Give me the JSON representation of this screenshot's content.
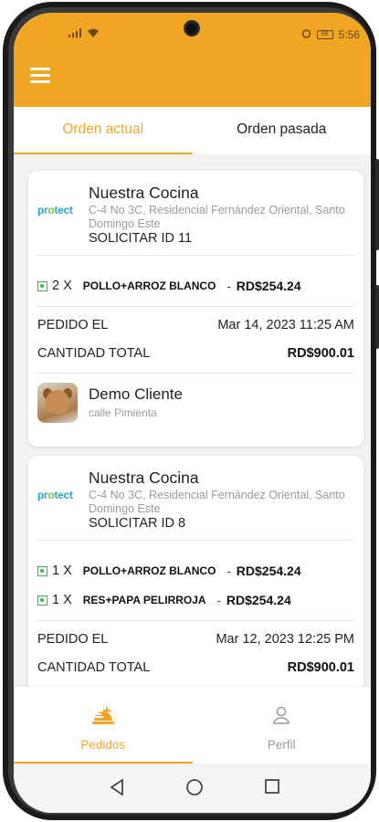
{
  "status_bar": {
    "time": "5:56",
    "battery_text": "88"
  },
  "tabs": [
    {
      "label": "Orden actual",
      "active": true
    },
    {
      "label": "Orden pasada",
      "active": false
    }
  ],
  "orders": [
    {
      "restaurant_logo": {
        "part1": "pr",
        "part2": "o",
        "part3": "tect"
      },
      "restaurant_name": "Nuestra Cocina",
      "address": "C-4 No 3C, Residencial Fernández Oriental, Santo Domingo Este",
      "request_id": "SOLICITAR ID 11",
      "items": [
        {
          "qty": "2 X",
          "name": "POLLO+ARROZ BLANCO",
          "dash": "-",
          "price": "RD$254.24"
        }
      ],
      "ordered_label": "PEDIDO EL",
      "ordered_date": "Mar 14, 2023 11:25 AM",
      "total_label": "CANTIDAD TOTAL",
      "total_value": "RD$900.01",
      "customer": {
        "name": "Demo Cliente",
        "address": "calle Pimienta"
      }
    },
    {
      "restaurant_logo": {
        "part1": "pr",
        "part2": "o",
        "part3": "tect"
      },
      "restaurant_name": "Nuestra Cocina",
      "address": "C-4 No 3C, Residencial Fernández Oriental, Santo Domingo Este",
      "request_id": "SOLICITAR ID 8",
      "items": [
        {
          "qty": "1 X",
          "name": "POLLO+ARROZ BLANCO",
          "dash": "-",
          "price": "RD$254.24"
        },
        {
          "qty": "1 X",
          "name": "RES+PAPA PELIRROJA",
          "dash": "-",
          "price": "RD$254.24"
        }
      ],
      "ordered_label": "PEDIDO EL",
      "ordered_date": "Mar 12, 2023 12:25 PM",
      "total_label": "CANTIDAD TOTAL",
      "total_value": "RD$900.01"
    }
  ],
  "bottom_nav": [
    {
      "label": "Pedidos",
      "icon": "food-tray-icon",
      "active": true
    },
    {
      "label": "Perfil",
      "icon": "user-icon",
      "active": false
    }
  ],
  "colors": {
    "accent": "#f0a623",
    "veg_green": "#2dbb4a"
  }
}
